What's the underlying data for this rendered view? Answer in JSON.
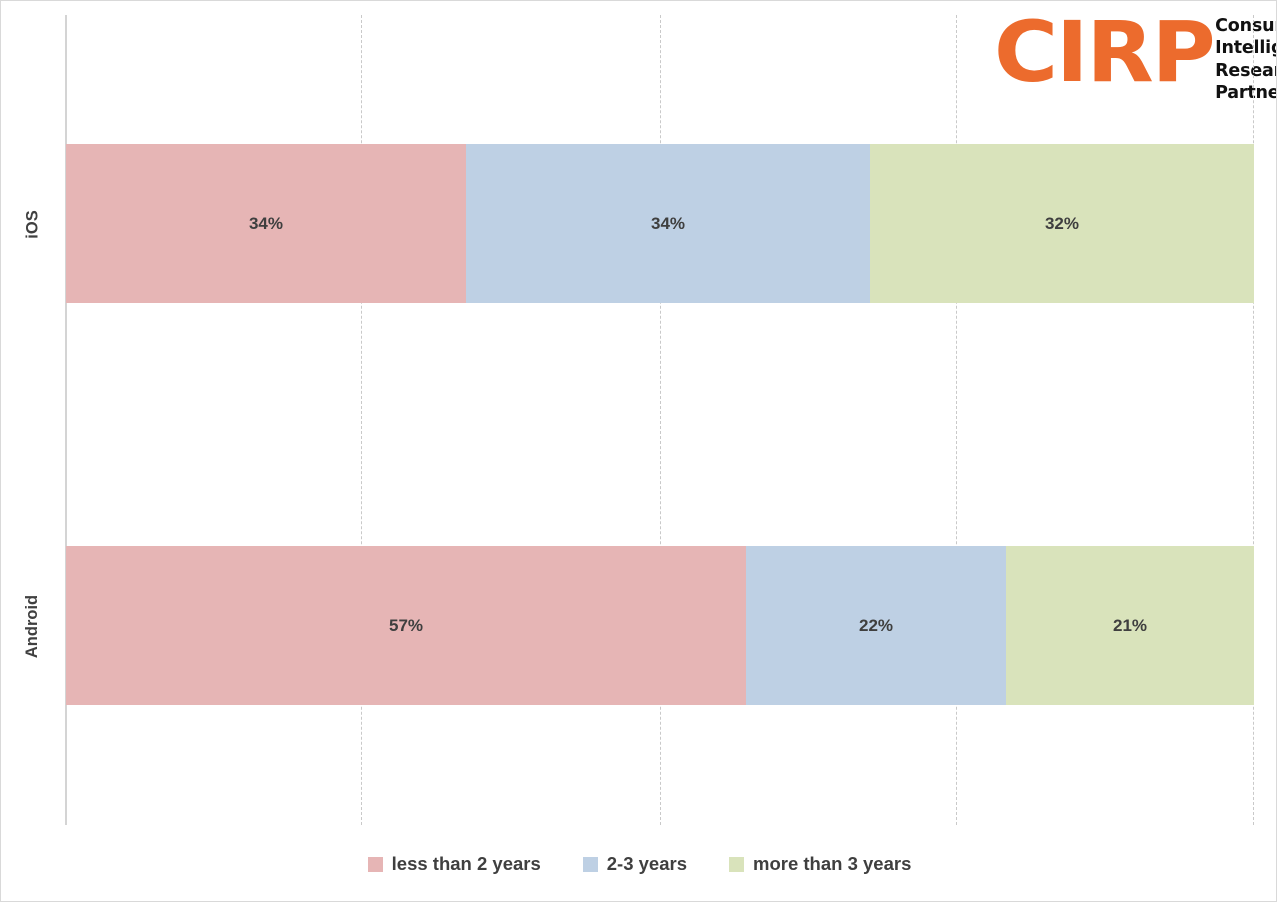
{
  "logo": {
    "mark": "CIRP",
    "name_line1": "Consumer",
    "name_line2": "Intelligence",
    "name_line3": "Research",
    "name_line4": "Partners, LLC",
    "mark_color": "#ec6b2d",
    "text_color": "#111111"
  },
  "chart_data": {
    "type": "bar",
    "orientation": "horizontal",
    "stacked": "100%",
    "title": "",
    "subtitle": "",
    "xlabel": "",
    "ylabel": "",
    "xlim": [
      0,
      100
    ],
    "grid": true,
    "gridline_values": [
      25,
      50,
      75,
      100
    ],
    "legend_position": "bottom",
    "categories": [
      "iOS",
      "Android"
    ],
    "series": [
      {
        "name": "less than 2 years",
        "color": "#e6b5b5",
        "values": [
          34,
          57
        ],
        "labels": [
          "34%",
          "57%"
        ]
      },
      {
        "name": "2-3 years",
        "color": "#bed0e4",
        "values": [
          34,
          22
        ],
        "labels": [
          "34%",
          "22%"
        ]
      },
      {
        "name": "more than 3 years",
        "color": "#d9e3bb",
        "values": [
          32,
          21
        ],
        "labels": [
          "32%",
          "21%"
        ]
      }
    ]
  },
  "axis": {
    "category_0": "iOS",
    "category_1": "Android"
  },
  "legend": {
    "items": [
      {
        "label": "less than 2 years",
        "color": "#e6b5b5"
      },
      {
        "label": "2-3 years",
        "color": "#bed0e4"
      },
      {
        "label": "more than 3 years",
        "color": "#d9e3bb"
      }
    ]
  },
  "bars": {
    "ios": {
      "seg0_label": "34%",
      "seg1_label": "34%",
      "seg2_label": "32%"
    },
    "android": {
      "seg0_label": "57%",
      "seg1_label": "22%",
      "seg2_label": "21%"
    }
  }
}
